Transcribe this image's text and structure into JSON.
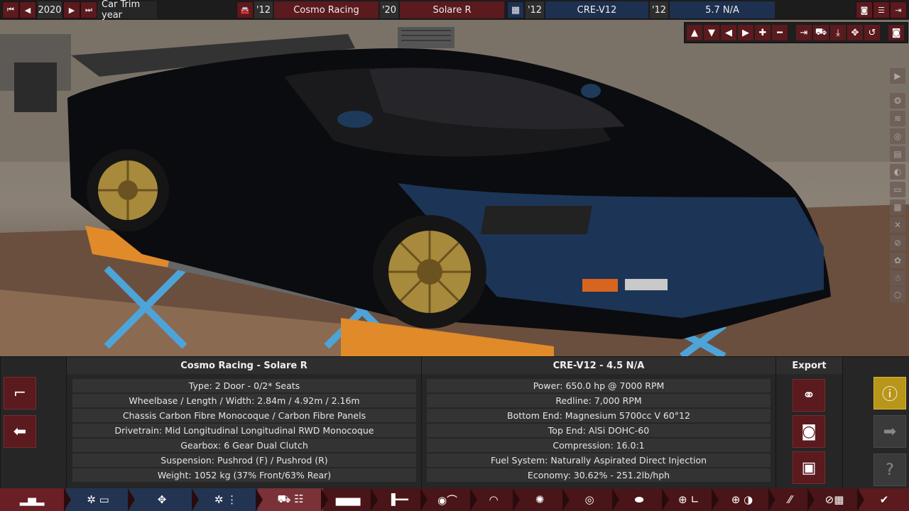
{
  "topbar": {
    "year": "2020",
    "trim_year_label": "Car Trim year",
    "model_year": "'12",
    "company": "Cosmo Racing",
    "trim_year": "'20",
    "trim": "Solare R",
    "engine_family_year": "'12",
    "engine_family": "CRE-V12",
    "engine_variant_year": "'12",
    "engine_variant": "5.7 N/A"
  },
  "car_panel": {
    "title": "Cosmo Racing - Solare R",
    "rows": [
      "Type: 2 Door - 0/2* Seats",
      "Wheelbase / Length / Width: 2.84m / 4.92m / 2.16m",
      "Chassis Carbon Fibre Monocoque / Carbon Fibre Panels",
      "Drivetrain: Mid Longitudinal Longitudinal RWD Monocoque",
      "Gearbox: 6 Gear Dual Clutch",
      "Suspension: Pushrod (F) / Pushrod (R)",
      "Weight: 1052 kg (37% Front/63% Rear)"
    ]
  },
  "engine_panel": {
    "title": "CRE-V12 - 4.5 N/A",
    "rows": [
      "Power: 650.0 hp @ 7000 RPM",
      "Redline:  7,000 RPM",
      "Bottom End: Magnesium 5700cc V 60°12",
      "Top End: AlSi DOHC-60",
      "Compression: 16.0:1",
      "Fuel System: Naturally Aspirated Direct Injection",
      "Economy: 30.62% - 251.2lb/hph"
    ]
  },
  "export_panel": {
    "title": "Export"
  },
  "icons": {
    "tool_row": [
      "arrow-up-icon",
      "arrow-down-icon",
      "arrow-left-icon",
      "arrow-right-icon",
      "plus-icon",
      "minus-icon",
      "snap-icon",
      "car-view-icon",
      "drop-icon",
      "rotate-move-icon",
      "reset-icon",
      "camera-icon"
    ],
    "side_tools": [
      "play-icon",
      "wheel-icon",
      "wing-icon",
      "headlight-icon",
      "grille-icon",
      "mirror-icon",
      "taillight-icon",
      "exhaust-icon",
      "vent-icon",
      "badge-icon",
      "fan-icon",
      "figure-icon",
      "circle-icon"
    ],
    "tabs": [
      "car-icon",
      "chassis-icon",
      "engine-icon",
      "engine-tune-icon",
      "car-trim-icon",
      "body-icon",
      "suspension-icon",
      "aero-icon",
      "wheels-icon",
      "brakes-icon",
      "interior-icon",
      "steering-icon",
      "tune-icon",
      "fuel-icon",
      "test-track-icon",
      "check-icon"
    ]
  },
  "colors": {
    "accent_red": "#5a1a1e",
    "accent_blue": "#1e3050",
    "warning_yellow": "#b8961a"
  }
}
